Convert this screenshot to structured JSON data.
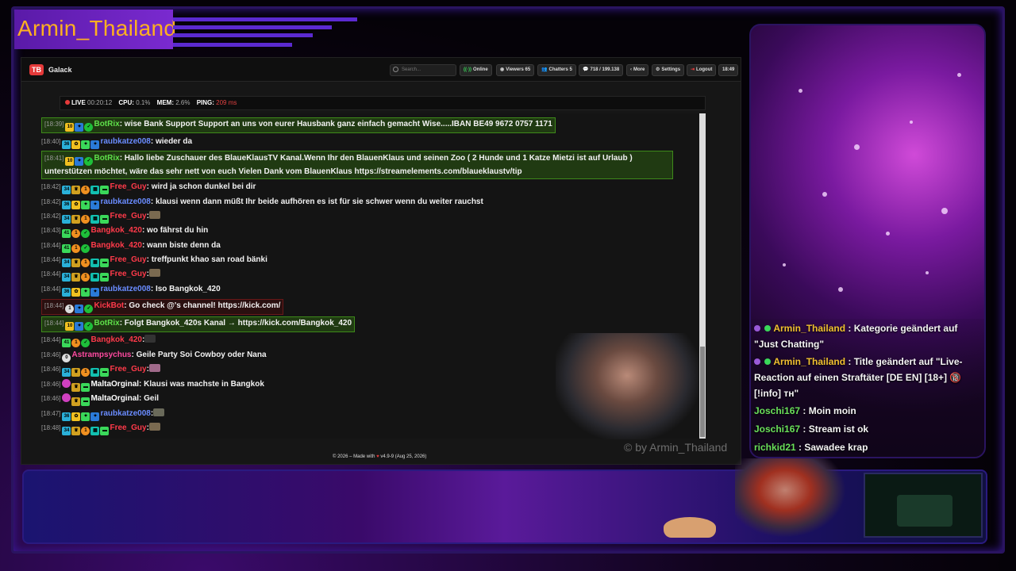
{
  "stream": {
    "title": "Armin_Thailand",
    "watermark": "© by Armin_Thailand"
  },
  "app": {
    "logo": "TB",
    "name": "Galack",
    "search_placeholder": "Search...",
    "buttons": {
      "online": "Online",
      "viewers_label": "Viewers",
      "viewers_count": "65",
      "chatters_label": "Chatters",
      "chatters_count": "5",
      "messages": "718 / 199.138",
      "more": "More",
      "settings": "Settings",
      "logout": "Logout",
      "clock": "18:49"
    },
    "status": {
      "live": "LIVE",
      "uptime": "00:20:12",
      "cpu_label": "CPU:",
      "cpu": "0.1%",
      "mem_label": "MEM:",
      "mem": "2.6%",
      "ping_label": "PING:",
      "ping": "209 ms"
    },
    "footer": {
      "prefix": "© 2026 – Made with",
      "suffix": "v4.9-9 (Aug 25, 2026)"
    }
  },
  "chat": [
    {
      "time": "[18:39]",
      "user": "BotRix",
      "text": ": wise Bank Support Support an uns von eurer Hausbank ganz einfach gemacht Wise.....IBAN BE49 9672 0757 1171"
    },
    {
      "time": "[18:40]",
      "user": "raubkatze008",
      "text": ": wieder da"
    },
    {
      "time": "[18:41]",
      "user": "BotRix",
      "text": ": Hallo liebe Zuschauer des BlaueKlausTV Kanal.Wenn Ihr den BlauenKlaus und seinen Zoo ( 2 Hunde und 1 Katze Mietzi ist auf Urlaub ) unterstützen möchtet, wäre das sehr nett von euch Vielen Dank vom BlauenKlaus https://streamelements.com/blaueklaustv/tip"
    },
    {
      "time": "[18:42]",
      "user": "Free_Guy",
      "text": ": wird ja schon dunkel bei dir"
    },
    {
      "time": "[18:42]",
      "user": "raubkatze008",
      "text": ": klausi wenn dann müßt Ihr beide aufhören es ist für sie schwer wenn du weiter rauchst"
    },
    {
      "time": "[18:42]",
      "user": "Free_Guy",
      "text": ":"
    },
    {
      "time": "[18:43]",
      "user": "Bangkok_420",
      "text": ": wo fährst du hin"
    },
    {
      "time": "[18:44]",
      "user": "Bangkok_420",
      "text": ": wann biste denn da"
    },
    {
      "time": "[18:44]",
      "user": "Free_Guy",
      "text": ": treffpunkt khao san road bänki"
    },
    {
      "time": "[18:44]",
      "user": "Free_Guy",
      "text": ":"
    },
    {
      "time": "[18:44]",
      "user": "raubkatze008",
      "text": ": Iso Bangkok_420"
    },
    {
      "time": "[18:44]",
      "user": "KickBot",
      "text": ": Go check @'s channel! https://kick.com/"
    },
    {
      "time": "[18:44]",
      "user": "BotRix",
      "text": ": Folgt Bangkok_420s Kanal → https://kick.com/Bangkok_420"
    },
    {
      "time": "[18:44]",
      "user": "Bangkok_420",
      "text": ":"
    },
    {
      "time": "[18:46]",
      "user": "Astrampsychus",
      "text": ": Geile Party Soi Cowboy oder Nana"
    },
    {
      "time": "[18:46]",
      "user": "Free_Guy",
      "text": ":"
    },
    {
      "time": "[18:46]",
      "user": "MaltaOrginal",
      "text": ": Klausi was machste in Bangkok"
    },
    {
      "time": "[18:46]",
      "user": "MaltaOrginal",
      "text": ": Geil"
    },
    {
      "time": "[18:47]",
      "user": "raubkatze008",
      "text": ":"
    },
    {
      "time": "[18:48]",
      "user": "Free_Guy",
      "text": ":"
    }
  ],
  "badges": {
    "level_10": "10",
    "level_36": "36",
    "level_34": "34",
    "level_41": "41",
    "one": "1",
    "zero": "0"
  },
  "overlay_chat": [
    {
      "user": "Armin_Thailand",
      "text": " : Kategorie geändert auf",
      "text2": "\"Just Chatting\""
    },
    {
      "user": "Armin_Thailand",
      "text": " : Title geändert auf \"Live-",
      "text2": "Reaction auf einen Straftäter [DE EN] [18+] 🔞",
      "text3": "[!info] ᴛʜ\""
    },
    {
      "user": "Joschi167",
      "text": " : Moin moin"
    },
    {
      "user": "Joschi167",
      "text": " : Stream ist ok"
    },
    {
      "user": "richkid21",
      "text": " : Sawadee krap"
    }
  ],
  "colors": {
    "accent": "#f0c030",
    "live": "#e53a3a",
    "bot": "#5ee04a"
  }
}
